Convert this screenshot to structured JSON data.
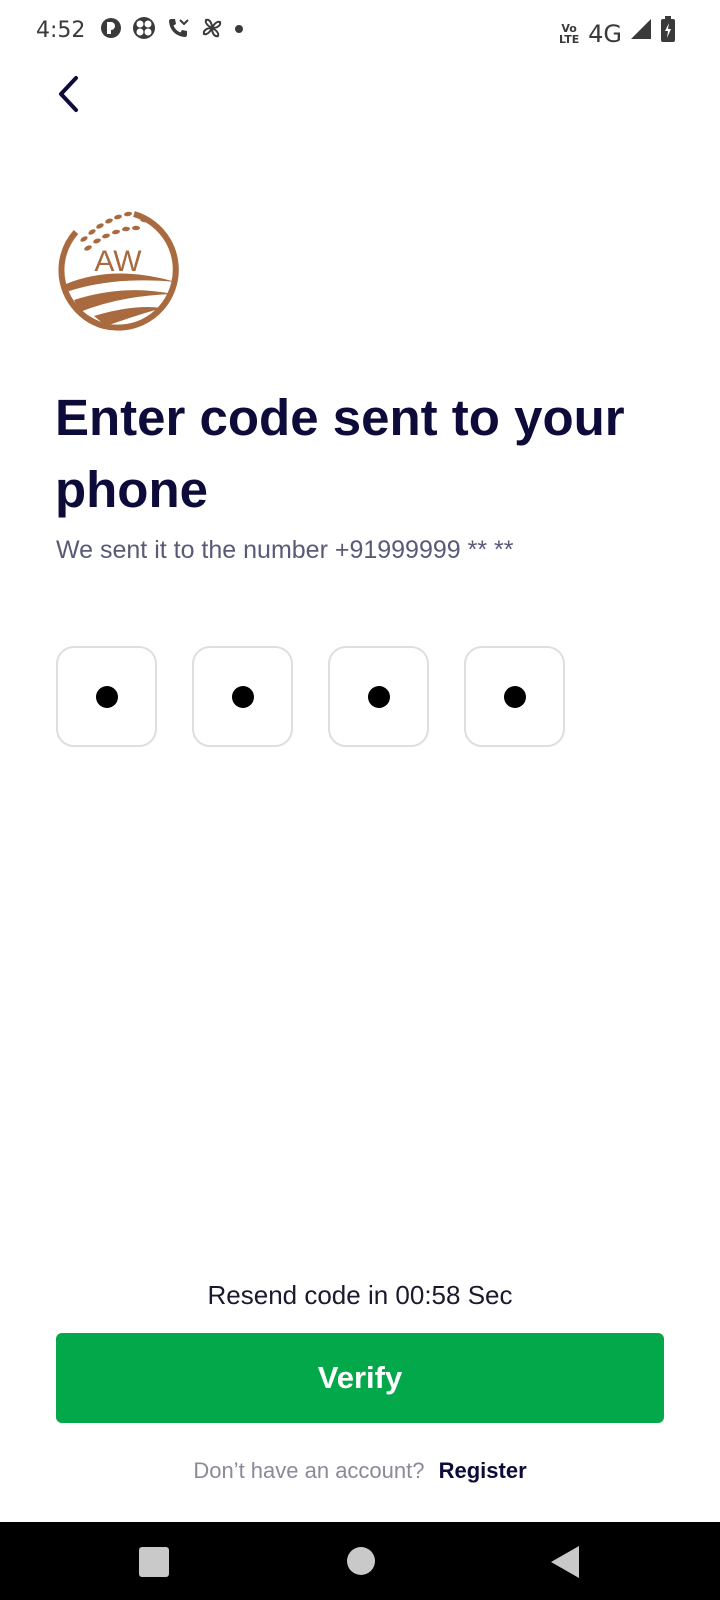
{
  "status_bar": {
    "time": "4:52",
    "left_icons": [
      "p-circle-icon",
      "fan-icon",
      "missed-call-icon",
      "pinwheel-icon",
      "dot-icon"
    ],
    "network_label": "4G",
    "volte_label": "Vo LTE"
  },
  "logo": {
    "text": "AW",
    "color": "#a86a3e"
  },
  "title": "Enter code sent to your phone",
  "subtitle": "We sent it to the number +91999999 ** **",
  "otp": {
    "length": 4,
    "masked": true
  },
  "resend_text": "Resend code in 00:58 Sec",
  "verify_label": "Verify",
  "register": {
    "prompt": "Don’t have an account?",
    "link": "Register"
  },
  "colors": {
    "primary": "#03a84a",
    "title": "#0d0b3a",
    "subtitle": "#5a5a78",
    "otp_border": "#dedede"
  }
}
